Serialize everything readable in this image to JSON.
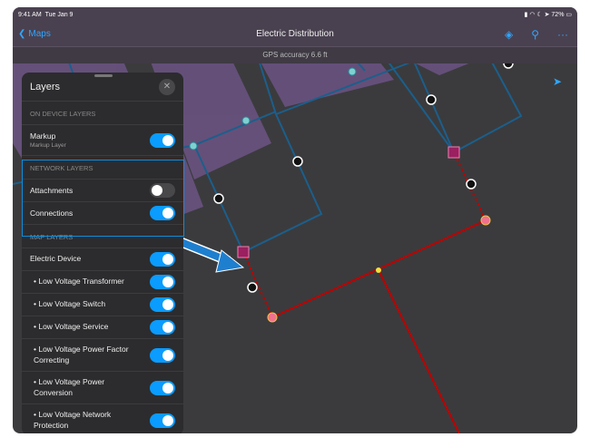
{
  "status": {
    "time": "9:41 AM",
    "date": "Tue Jan 9",
    "battery": "72%"
  },
  "nav": {
    "back_label": "Maps",
    "title": "Electric Distribution"
  },
  "gps": "GPS accuracy 6.6 ft",
  "panel": {
    "title": "Layers",
    "on_device_header": "ON DEVICE LAYERS",
    "markup": {
      "label": "Markup",
      "sub": "Markup Layer",
      "on": true
    },
    "network_header": "NETWORK LAYERS",
    "attachments": {
      "label": "Attachments",
      "on": false
    },
    "connections": {
      "label": "Connections",
      "on": true
    },
    "map_header": "MAP LAYERS",
    "map_layers": [
      {
        "label": "Electric Device",
        "on": true
      },
      {
        "label": "• Low Voltage Transformer",
        "on": true
      },
      {
        "label": "• Low Voltage Switch",
        "on": true
      },
      {
        "label": "• Low Voltage Service",
        "on": true
      },
      {
        "label": "• Low Voltage Power Factor Correcting",
        "on": true
      },
      {
        "label": "• Low Voltage Power Conversion",
        "on": true
      },
      {
        "label": "• Low Voltage Network Protection",
        "on": true
      }
    ]
  },
  "colors": {
    "accent": "#0a9cff",
    "parcel": "#6a5380",
    "line_blue": "#1b5f8c",
    "line_red": "#c00000"
  }
}
